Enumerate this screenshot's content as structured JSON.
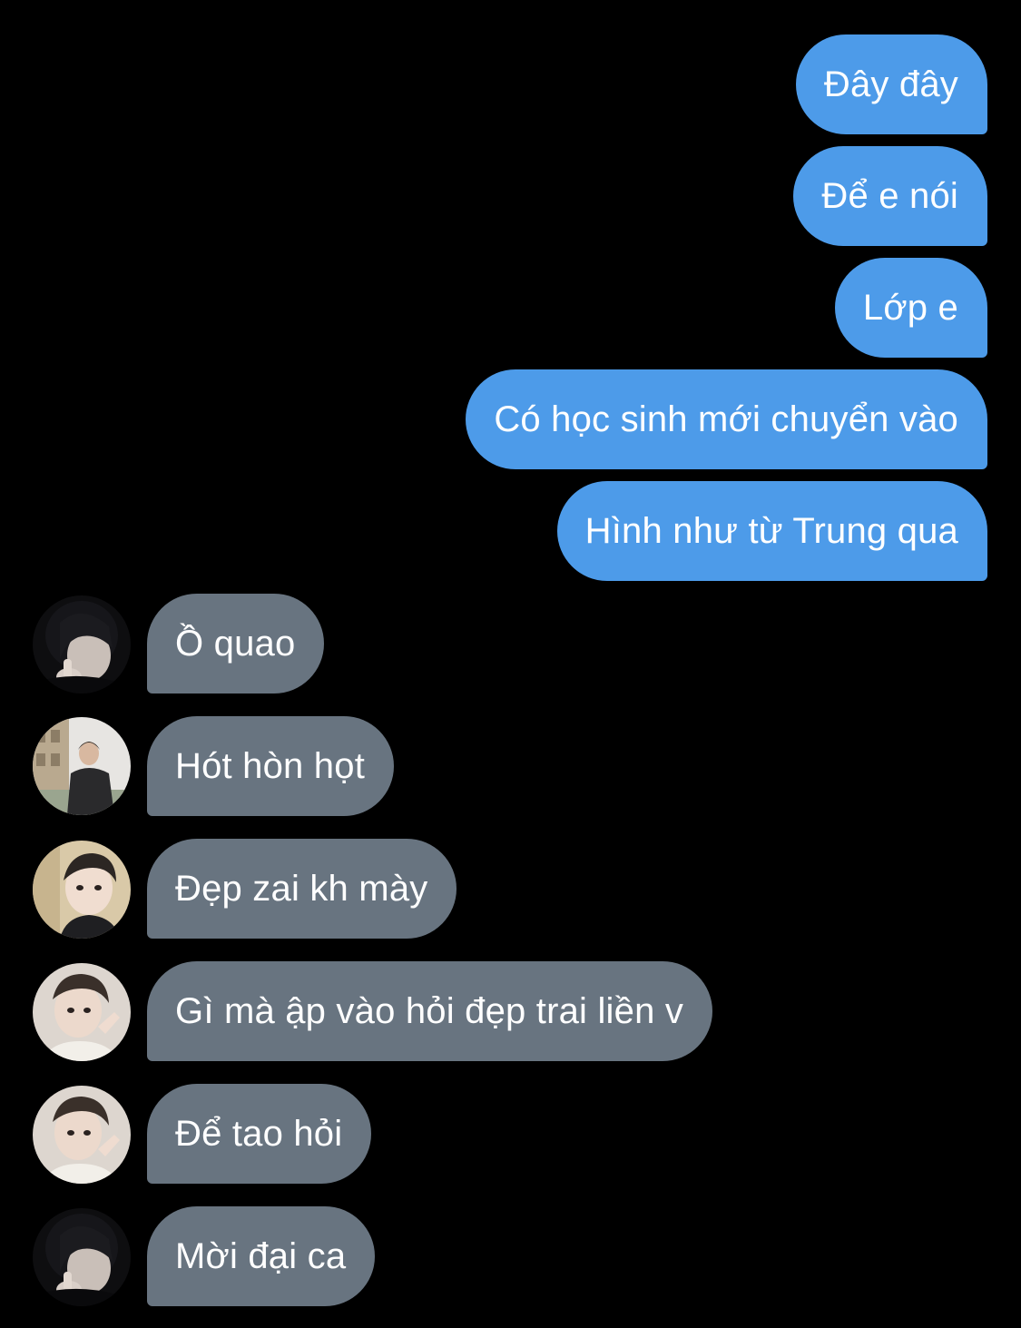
{
  "conversation": {
    "sent": [
      {
        "text": "Đây đây"
      },
      {
        "text": "Để e nói"
      },
      {
        "text": "Lớp e"
      },
      {
        "text": "Có học sinh mới chuyển vào"
      },
      {
        "text": "Hình như từ Trung qua"
      }
    ],
    "received": [
      {
        "text": "Ồ quao",
        "avatar": "avatar-dark-hood"
      },
      {
        "text": "Hót hòn họt",
        "avatar": "avatar-outdoor"
      },
      {
        "text": "Đẹp zai kh mày",
        "avatar": "avatar-selfie"
      },
      {
        "text": "Gì mà ập vào hỏi đẹp trai liền v",
        "avatar": "avatar-pose"
      },
      {
        "text": "Để tao hỏi",
        "avatar": "avatar-pose"
      },
      {
        "text": "Mời đại ca",
        "avatar": "avatar-dark-hood"
      }
    ]
  },
  "colors": {
    "background": "#000000",
    "sent_bubble": "#4d9be9",
    "received_bubble": "#687480",
    "text": "#ffffff"
  }
}
